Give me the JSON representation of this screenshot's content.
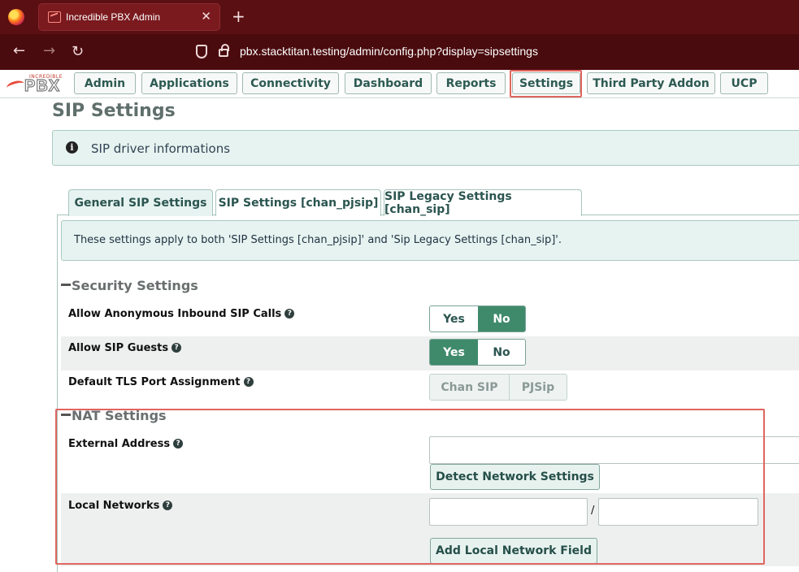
{
  "browser": {
    "tab_title": "Incredible PBX Admin",
    "url": "pbx.stacktitan.testing/admin/config.php?display=sipsettings",
    "icons": [
      "firefox-logo",
      "back-arrow-icon",
      "forward-arrow-icon",
      "reload-icon",
      "shield-icon",
      "lock-icon",
      "close-icon",
      "plus-icon"
    ]
  },
  "logo": {
    "small": "INCREDIBLE",
    "big": "PBX"
  },
  "menu": {
    "items": [
      "Admin",
      "Applications",
      "Connectivity",
      "Dashboard",
      "Reports",
      "Settings",
      "Third Party Addon",
      "UCP"
    ],
    "highlighted": "Settings"
  },
  "page": {
    "title": "SIP Settings",
    "info": "SIP driver informations",
    "tabs": [
      "General SIP Settings",
      "SIP Settings [chan_pjsip]",
      "SIP Legacy Settings [chan_sip]"
    ],
    "active_tab": "General SIP Settings",
    "note": "These settings apply to both 'SIP Settings [chan_pjsip]' and 'Sip Legacy Settings [chan_sip]'."
  },
  "security": {
    "title": "Security Settings",
    "anon": {
      "label": "Allow Anonymous Inbound SIP Calls",
      "yes": "Yes",
      "no": "No",
      "selected": "No"
    },
    "guests": {
      "label": "Allow SIP Guests",
      "yes": "Yes",
      "no": "No",
      "selected": "Yes"
    },
    "tls": {
      "label": "Default TLS Port Assignment",
      "opt1": "Chan SIP",
      "opt2": "PJSip"
    }
  },
  "nat": {
    "title": "NAT Settings",
    "external": {
      "label": "External Address",
      "value": "",
      "button": "Detect Network Settings"
    },
    "local": {
      "label": "Local Networks",
      "separator": "/",
      "ip": "",
      "mask": "",
      "button": "Add Local Network Field"
    }
  },
  "colors": {
    "accent": "#3f8a6b",
    "highlight": "#e0655f",
    "browser": "#5a0f12"
  }
}
